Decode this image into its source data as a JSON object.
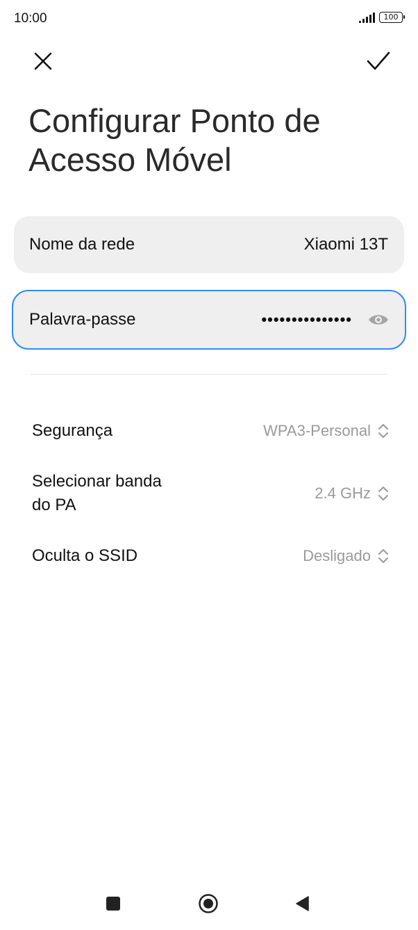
{
  "status_bar": {
    "time": "10:00",
    "battery": "100"
  },
  "toolbar": {
    "close_icon": "close-icon",
    "confirm_icon": "check-icon"
  },
  "page": {
    "title": "Configurar Ponto de Acesso Móvel"
  },
  "fields": {
    "network_name": {
      "label": "Nome da rede",
      "value": "Xiaomi 13T"
    },
    "password": {
      "label": "Palavra-passe",
      "value": "•••••••••••••••",
      "icon": "eye-icon"
    }
  },
  "settings": [
    {
      "label": "Segurança",
      "value": "WPA3-Personal"
    },
    {
      "label": "Selecionar banda do PA",
      "value": "2.4 GHz"
    },
    {
      "label": "Oculta o SSID",
      "value": "Desligado"
    }
  ],
  "colors": {
    "accent": "#2f8bf3",
    "field_bg": "#efefef",
    "secondary_text": "#9a9a9a"
  },
  "nav_bar": {
    "recent_icon": "square-icon",
    "home_icon": "circle-icon",
    "back_icon": "triangle-back-icon"
  }
}
